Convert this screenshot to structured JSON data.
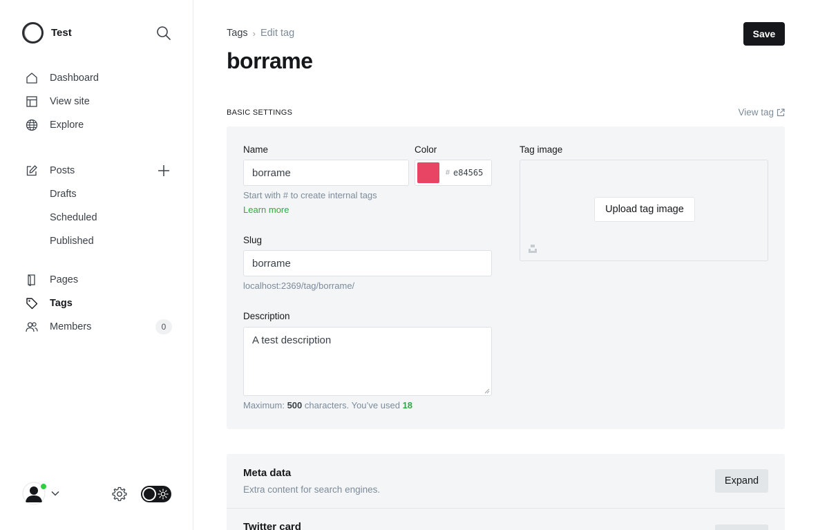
{
  "sidebar": {
    "site_name": "Test",
    "nav_primary": [
      {
        "label": "Dashboard",
        "icon": "home-icon"
      },
      {
        "label": "View site",
        "icon": "layout-icon"
      },
      {
        "label": "Explore",
        "icon": "globe-icon"
      }
    ],
    "nav_posts": {
      "label": "Posts",
      "icon": "edit-icon",
      "sub_items": [
        "Drafts",
        "Scheduled",
        "Published"
      ]
    },
    "nav_secondary": [
      {
        "label": "Pages",
        "icon": "page-icon"
      },
      {
        "label": "Tags",
        "icon": "tag-icon",
        "active": true
      },
      {
        "label": "Members",
        "icon": "members-icon",
        "count": "0"
      }
    ]
  },
  "header": {
    "breadcrumb_parent": "Tags",
    "breadcrumb_current": "Edit tag",
    "title": "borrame",
    "save_label": "Save"
  },
  "basic_settings": {
    "section_title": "BASIC SETTINGS",
    "view_tag_label": "View tag",
    "name_label": "Name",
    "name_value": "borrame",
    "name_hint": "Start with # to create internal tags",
    "learn_more": "Learn more",
    "color_label": "Color",
    "color_hash": "#",
    "color_value": "e84565",
    "color_swatch": "#e84565",
    "slug_label": "Slug",
    "slug_value": "borrame",
    "slug_url": "localhost:2369/tag/borrame/",
    "description_label": "Description",
    "description_value": "A test description",
    "counter_prefix": "Maximum:",
    "counter_max": "500",
    "counter_mid": "characters. You’ve used",
    "counter_used": "18",
    "tag_image_label": "Tag image",
    "upload_label": "Upload tag image"
  },
  "meta_data": {
    "title": "Meta data",
    "subtitle": "Extra content for search engines.",
    "expand_label": "Expand"
  },
  "twitter_card": {
    "title": "Twitter card"
  },
  "colors": {
    "accent_green": "#30a944",
    "online_dot": "#30cf43",
    "primary_dark": "#15171a"
  }
}
